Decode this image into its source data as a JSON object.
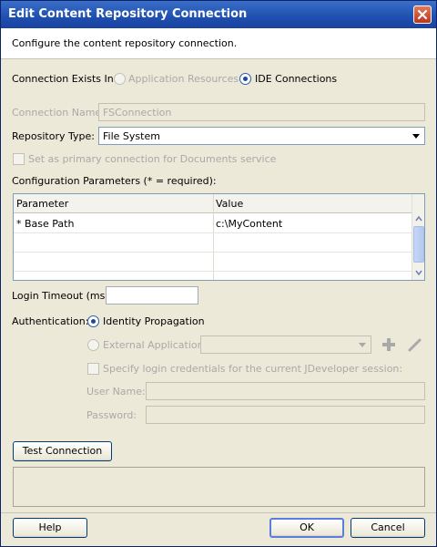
{
  "window": {
    "title": "Edit Content Repository Connection",
    "close_icon": "close-icon"
  },
  "header": {
    "description": "Configure the content repository connection."
  },
  "connection_exists": {
    "label": "Connection Exists In:",
    "options": [
      "Application Resources",
      "IDE Connections"
    ],
    "selected": "IDE Connections"
  },
  "connection_name": {
    "label": "Connection Name:",
    "value": "FSConnection"
  },
  "repository_type": {
    "label": "Repository Type:",
    "value": "File System"
  },
  "primary_connection": {
    "label": "Set as primary connection for Documents service",
    "checked": false
  },
  "config_params": {
    "label": "Configuration Parameters (* = required):",
    "columns": [
      "Parameter",
      "Value"
    ],
    "rows": [
      {
        "parameter": "* Base Path",
        "value": "c:\\MyContent"
      }
    ]
  },
  "login_timeout": {
    "label": "Login Timeout (ms):",
    "value": ""
  },
  "authentication": {
    "label": "Authentication:",
    "identity_propagation": "Identity Propagation",
    "external_application": "External Application:",
    "external_value": "",
    "specify_credentials": "Specify login credentials for the current JDeveloper session:",
    "user_name_label": "User Name:",
    "password_label": "Password:",
    "user_name_value": "",
    "password_value": ""
  },
  "buttons": {
    "test_connection": "Test Connection",
    "help": "Help",
    "ok": "OK",
    "cancel": "Cancel"
  },
  "colors": {
    "title_bar": "#1e4fb0",
    "accent": "#1d4aa0",
    "dialog_bg": "#ece9d8"
  }
}
